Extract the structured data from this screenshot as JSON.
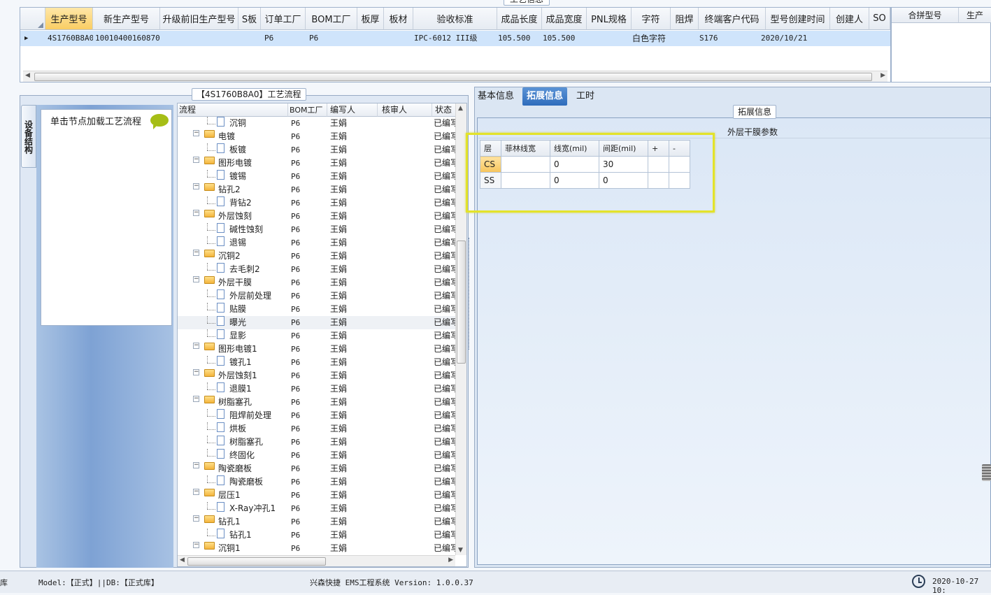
{
  "top_section_label": "工艺信息",
  "top_grid": {
    "columns": [
      "",
      "生产型号",
      "新生产型号",
      "升级前旧生产型号",
      "S板",
      "订单工厂",
      "BOM工厂",
      "板厚",
      "板材",
      "验收标准",
      "成品长度",
      "成品宽度",
      "PNL规格",
      "字符",
      "阻焊",
      "终端客户代码",
      "型号创建时间",
      "创建人",
      "SO"
    ],
    "row": {
      "marker": "▶",
      "prod_no": "4S1760B8A0",
      "new_prod_no": "10010400160870",
      "order_factory": "P6",
      "bom_factory": "P6",
      "standard": "IPC-6012 III级",
      "length": "105.500",
      "width": "105.500",
      "char": "白色字符",
      "customer_code": "S176",
      "created": "2020/10/21"
    }
  },
  "merge_panel": {
    "col1": "合拼型号",
    "col2": "生产"
  },
  "process_panel": {
    "title": "【4S1760B8A0】工艺流程",
    "side_tab": "设备结构",
    "load_hint": "单击节点加载工艺流程",
    "columns": [
      "流程",
      "BOM工厂",
      "编写人",
      "核审人",
      "状态"
    ],
    "rows": [
      {
        "name": "沉铜",
        "f": "P6",
        "w": "王娟",
        "s": "已编写",
        "level": 2
      },
      {
        "name": "电镀",
        "f": "P6",
        "w": "王娟",
        "s": "已编写",
        "level": 1
      },
      {
        "name": "板镀",
        "f": "P6",
        "w": "王娟",
        "s": "已编写",
        "level": 2
      },
      {
        "name": "图形电镀",
        "f": "P6",
        "w": "王娟",
        "s": "已编写",
        "level": 1
      },
      {
        "name": "镀锡",
        "f": "P6",
        "w": "王娟",
        "s": "已编写",
        "level": 2
      },
      {
        "name": "钻孔2",
        "f": "P6",
        "w": "王娟",
        "s": "已编写",
        "level": 1
      },
      {
        "name": "背钻2",
        "f": "P6",
        "w": "王娟",
        "s": "已编写",
        "level": 2
      },
      {
        "name": "外层蚀刻",
        "f": "P6",
        "w": "王娟",
        "s": "已编写",
        "level": 1
      },
      {
        "name": "碱性蚀刻",
        "f": "P6",
        "w": "王娟",
        "s": "已编写",
        "level": 2
      },
      {
        "name": "退锡",
        "f": "P6",
        "w": "王娟",
        "s": "已编写",
        "level": 2
      },
      {
        "name": "沉铜2",
        "f": "P6",
        "w": "王娟",
        "s": "已编写",
        "level": 1
      },
      {
        "name": "去毛刺2",
        "f": "P6",
        "w": "王娟",
        "s": "已编写",
        "level": 2
      },
      {
        "name": "外层干膜",
        "f": "P6",
        "w": "王娟",
        "s": "已编写",
        "level": 1
      },
      {
        "name": "外层前处理",
        "f": "P6",
        "w": "王娟",
        "s": "已编写",
        "level": 2
      },
      {
        "name": "贴膜",
        "f": "P6",
        "w": "王娟",
        "s": "已编写",
        "level": 2
      },
      {
        "name": "曝光",
        "f": "P6",
        "w": "王娟",
        "s": "已编写",
        "level": 2,
        "selected": true
      },
      {
        "name": "显影",
        "f": "P6",
        "w": "王娟",
        "s": "已编写",
        "level": 2
      },
      {
        "name": "图形电镀1",
        "f": "P6",
        "w": "王娟",
        "s": "已编写",
        "level": 1
      },
      {
        "name": "镀孔1",
        "f": "P6",
        "w": "王娟",
        "s": "已编写",
        "level": 2
      },
      {
        "name": "外层蚀刻1",
        "f": "P6",
        "w": "王娟",
        "s": "已编写",
        "level": 1
      },
      {
        "name": "退膜1",
        "f": "P6",
        "w": "王娟",
        "s": "已编写",
        "level": 2
      },
      {
        "name": "树脂塞孔",
        "f": "P6",
        "w": "王娟",
        "s": "已编写",
        "level": 1
      },
      {
        "name": "阻焊前处理",
        "f": "P6",
        "w": "王娟",
        "s": "已编写",
        "level": 2
      },
      {
        "name": "烘板",
        "f": "P6",
        "w": "王娟",
        "s": "已编写",
        "level": 2
      },
      {
        "name": "树脂塞孔",
        "f": "P6",
        "w": "王娟",
        "s": "已编写",
        "level": 2
      },
      {
        "name": "终固化",
        "f": "P6",
        "w": "王娟",
        "s": "已编写",
        "level": 2
      },
      {
        "name": "陶瓷磨板",
        "f": "P6",
        "w": "王娟",
        "s": "已编写",
        "level": 1
      },
      {
        "name": "陶瓷磨板",
        "f": "P6",
        "w": "王娟",
        "s": "已编写",
        "level": 2
      },
      {
        "name": "层压1",
        "f": "P6",
        "w": "王娟",
        "s": "已编写",
        "level": 1
      },
      {
        "name": "X-Ray冲孔1",
        "f": "P6",
        "w": "王娟",
        "s": "已编写",
        "level": 2
      },
      {
        "name": "钻孔1",
        "f": "P6",
        "w": "王娟",
        "s": "已编写",
        "level": 1
      },
      {
        "name": "钻孔1",
        "f": "P6",
        "w": "王娟",
        "s": "已编写",
        "level": 2
      },
      {
        "name": "沉铜1",
        "f": "P6",
        "w": "王娟",
        "s": "已编写",
        "level": 1
      }
    ]
  },
  "tabs": [
    "基本信息",
    "拓展信息",
    "工时"
  ],
  "active_tab": 1,
  "ext_panel": {
    "title": "拓展信息",
    "section": "外层干膜参数",
    "columns": [
      "层",
      "菲林线宽",
      "线宽(mil)",
      "间距(mil)",
      "+",
      "-"
    ],
    "rows": [
      {
        "layer": "CS",
        "film": "",
        "width": "0",
        "spacing": "30"
      },
      {
        "layer": "SS",
        "film": "",
        "width": "0",
        "spacing": "0"
      }
    ]
  },
  "status": {
    "left": "库",
    "model": "Model:【正式】||DB:【正式库】",
    "app": "兴森快捷 EMS工程系统 Version: 1.0.0.37",
    "time": "2020-10-27 10:"
  },
  "colors": {
    "accent": "#2e6cbc",
    "highlight": "#e3e32a",
    "selected_header": "#f9cd63"
  }
}
